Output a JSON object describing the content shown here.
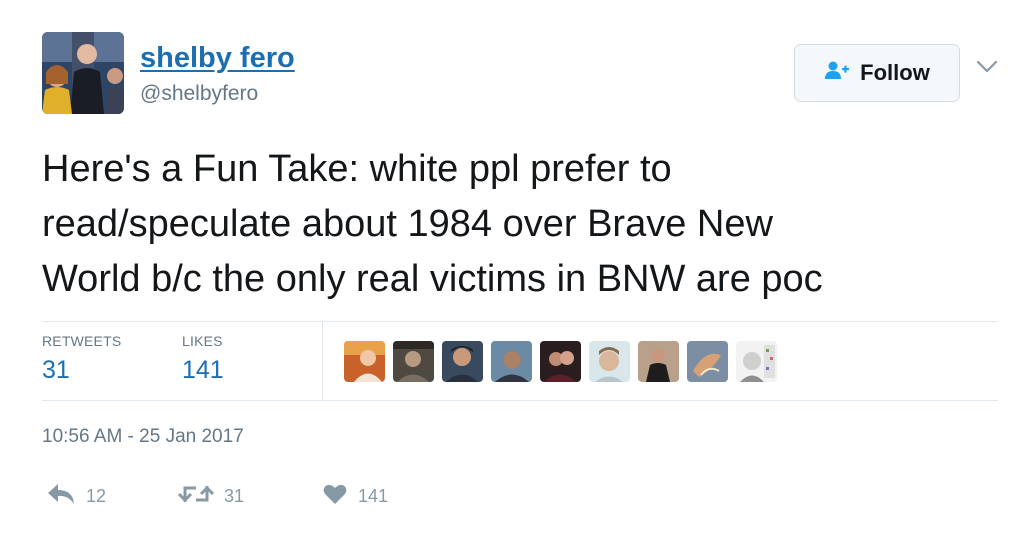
{
  "author": {
    "name": "shelby fero",
    "handle": "@shelbyfero"
  },
  "follow_label": "Follow",
  "text_lines": [
    "Here's a Fun Take: white ppl prefer to",
    "read/speculate about 1984 over Brave New",
    "World b/c the only real victims in BNW are poc"
  ],
  "stats": {
    "retweets_label": "RETWEETS",
    "retweets": "31",
    "likes_label": "LIKES",
    "likes": "141"
  },
  "timestamp": "10:56 AM - 25 Jan 2017",
  "actions": {
    "reply_count": "12",
    "retweet_count": "31",
    "like_count": "141"
  },
  "colors": {
    "link": "#1b6fb0",
    "muted": "#657786",
    "divider": "#e1e8ed"
  },
  "icons": [
    "add-user-icon",
    "chevron-down-icon",
    "reply-icon",
    "retweet-icon",
    "heart-icon"
  ]
}
